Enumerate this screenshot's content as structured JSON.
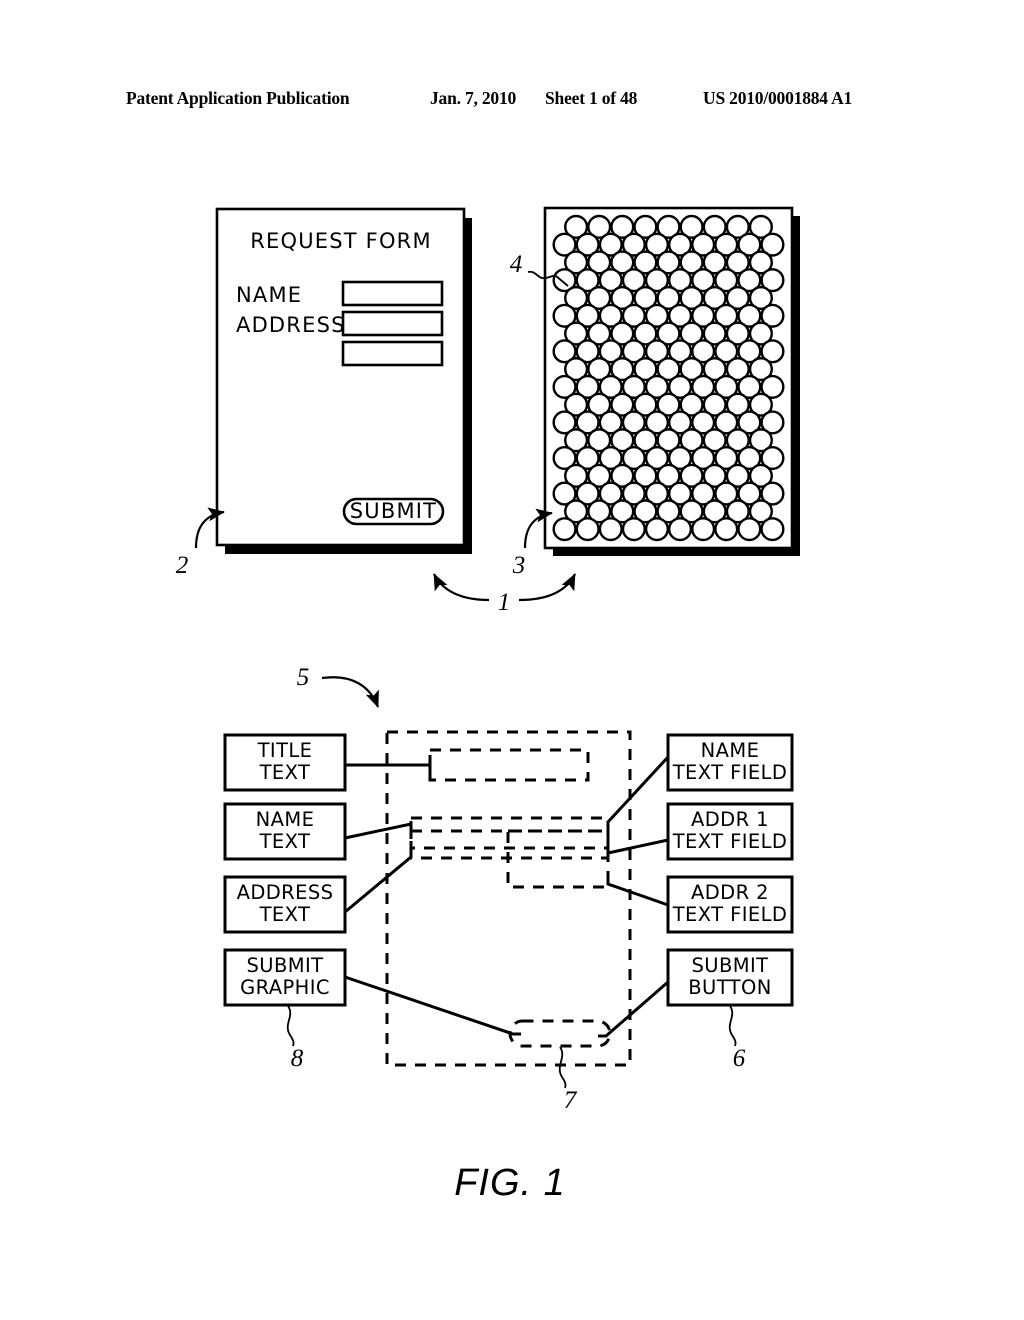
{
  "header": {
    "publication": "Patent Application Publication",
    "date": "Jan. 7, 2010",
    "sheet": "Sheet 1 of 48",
    "doc_number": "US 2010/0001884 A1"
  },
  "figure": {
    "caption": "FIG. 1",
    "reference_numerals": {
      "n1": "1",
      "n2": "2",
      "n3": "3",
      "n4": "4",
      "n5": "5",
      "n6": "6",
      "n7": "7",
      "n8": "8"
    }
  },
  "form": {
    "title": "REQUEST FORM",
    "labels": {
      "name": "NAME",
      "address": "ADDRESS"
    },
    "submit_label": "SUBMIT",
    "field_count": 3
  },
  "dot_panel": {
    "rows": 18,
    "cols_long": 10,
    "cols_short": 9,
    "description": "coded-data dot pattern"
  },
  "mapping_diagram": {
    "left_boxes": [
      {
        "line1": "TITLE",
        "line2": "TEXT"
      },
      {
        "line1": "NAME",
        "line2": "TEXT"
      },
      {
        "line1": "ADDRESS",
        "line2": "TEXT"
      },
      {
        "line1": "SUBMIT",
        "line2": "GRAPHIC"
      }
    ],
    "right_boxes": [
      {
        "line1": "NAME",
        "line2": "TEXT FIELD"
      },
      {
        "line1": "ADDR 1",
        "line2": "TEXT FIELD"
      },
      {
        "line1": "ADDR 2",
        "line2": "TEXT FIELD"
      },
      {
        "line1": "SUBMIT",
        "line2": "BUTTON"
      }
    ]
  },
  "colors": {
    "ink": "#000000",
    "paper": "#ffffff"
  }
}
